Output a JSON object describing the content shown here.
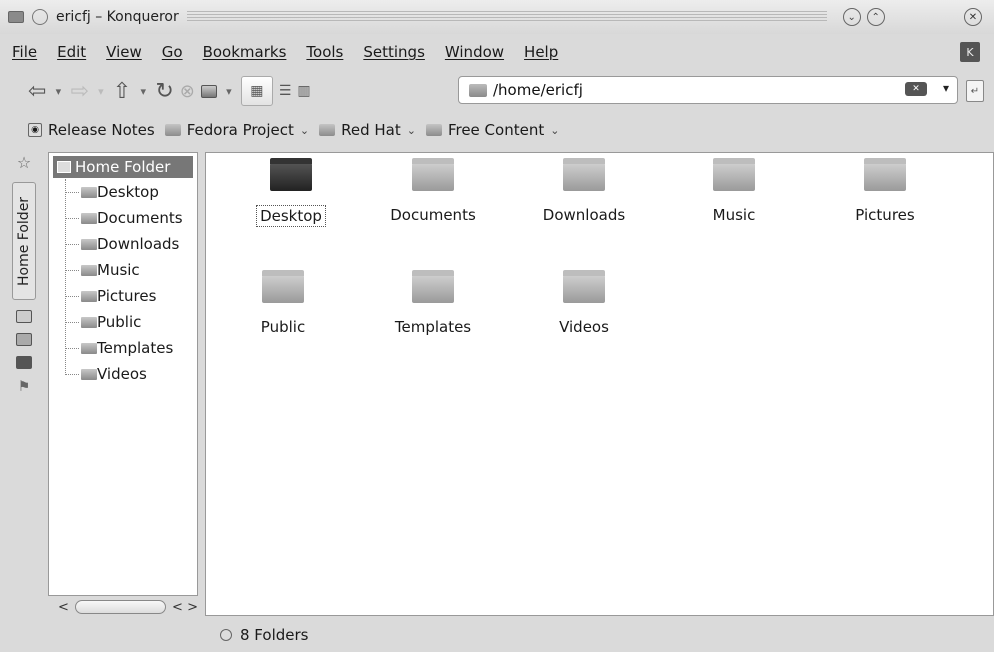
{
  "window": {
    "title": "ericfj – Konqueror"
  },
  "menu": [
    "File",
    "Edit",
    "View",
    "Go",
    "Bookmarks",
    "Tools",
    "Settings",
    "Window",
    "Help"
  ],
  "address": {
    "path": "/home/ericfj"
  },
  "bookmarks": [
    {
      "label": "Release Notes",
      "chevron": false
    },
    {
      "label": "Fedora Project",
      "chevron": true
    },
    {
      "label": "Red Hat",
      "chevron": true
    },
    {
      "label": "Free Content",
      "chevron": true
    }
  ],
  "sidebar": {
    "tab_label": "Home Folder"
  },
  "tree": {
    "root": "Home Folder",
    "items": [
      "Desktop",
      "Documents",
      "Downloads",
      "Music",
      "Pictures",
      "Public",
      "Templates",
      "Videos"
    ]
  },
  "files": [
    {
      "name": "Desktop",
      "selected": true,
      "icon": "desktop-folder-icon"
    },
    {
      "name": "Documents",
      "selected": false,
      "icon": "folder-icon"
    },
    {
      "name": "Downloads",
      "selected": false,
      "icon": "folder-icon"
    },
    {
      "name": "Music",
      "selected": false,
      "icon": "folder-icon"
    },
    {
      "name": "Pictures",
      "selected": false,
      "icon": "folder-icon"
    },
    {
      "name": "Public",
      "selected": false,
      "icon": "folder-icon"
    },
    {
      "name": "Templates",
      "selected": false,
      "icon": "folder-icon"
    },
    {
      "name": "Videos",
      "selected": false,
      "icon": "folder-icon"
    }
  ],
  "status": {
    "text": "8 Folders"
  }
}
